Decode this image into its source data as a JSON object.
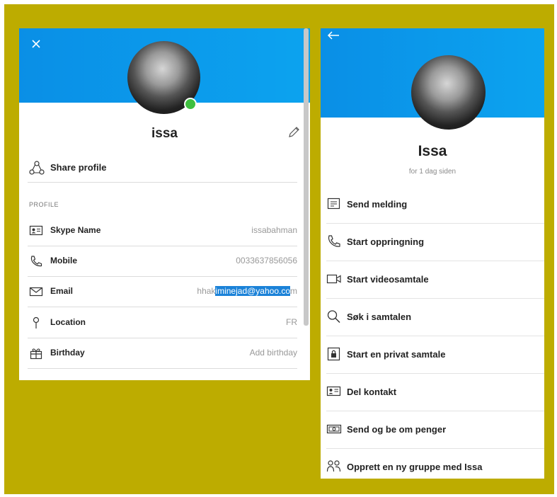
{
  "left_panel": {
    "name": "issa",
    "share_label": "Share profile",
    "section_title": "PROFILE",
    "fields": [
      {
        "label": "Skype Name",
        "value": "issabahman",
        "icon": "contact-card-icon"
      },
      {
        "label": "Mobile",
        "value": "0033637856056",
        "icon": "phone-icon"
      },
      {
        "label": "Email",
        "value_prefix": "hhak",
        "value_selected": "iminejad@yahoo.co",
        "value_suffix": "m",
        "icon": "mail-icon"
      },
      {
        "label": "Location",
        "value": "FR",
        "icon": "location-pin-icon"
      },
      {
        "label": "Birthday",
        "value": "Add birthday",
        "icon": "gift-icon"
      }
    ],
    "presence_color": "#3fbf3f"
  },
  "right_panel": {
    "name": "Issa",
    "status": "for 1 dag siden",
    "actions": [
      {
        "label": "Send melding",
        "icon": "message-icon"
      },
      {
        "label": "Start oppringning",
        "icon": "phone-icon"
      },
      {
        "label": "Start videosamtale",
        "icon": "video-camera-icon"
      },
      {
        "label": "Søk i samtalen",
        "icon": "search-icon"
      },
      {
        "label": "Start en privat samtale",
        "icon": "lock-icon"
      },
      {
        "label": "Del kontakt",
        "icon": "contact-card-icon"
      },
      {
        "label": "Send og be om penger",
        "icon": "money-icon"
      },
      {
        "label": "Opprett en ny gruppe med Issa",
        "icon": "group-icon"
      }
    ]
  },
  "colors": {
    "frame": "#bdac00",
    "banner": "#0ca3ef",
    "selection": "#1b82d8"
  }
}
